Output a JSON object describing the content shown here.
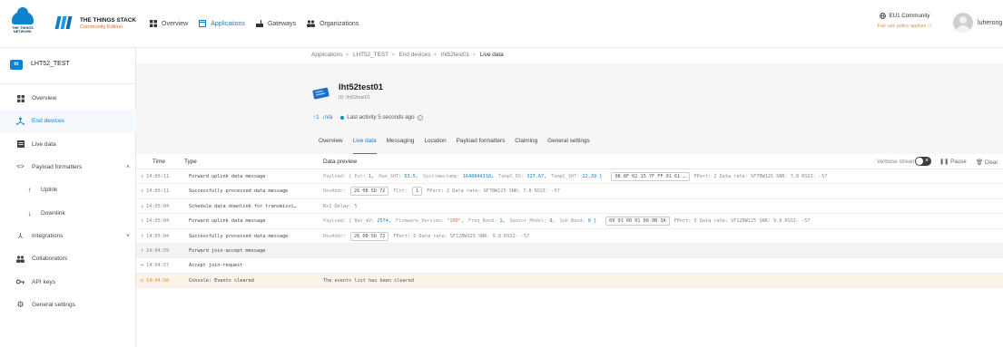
{
  "topbar": {
    "ttn_logo_text": "THE THINGS NETWORK",
    "stack_title": "THE THINGS STACK",
    "stack_edition": "Community Edition",
    "nav": [
      {
        "label": "Overview",
        "icon": "grid-icon"
      },
      {
        "label": "Applications",
        "icon": "window-icon",
        "active": true
      },
      {
        "label": "Gateways",
        "icon": "gateway-icon"
      },
      {
        "label": "Organizations",
        "icon": "people-icon"
      }
    ],
    "community": "EU1 Community",
    "fair_use": "Fair use policy applies ⓘ",
    "username": "luherong"
  },
  "sidebar": {
    "app_badge": "ttt",
    "app_name": "LHT52_TEST",
    "items": [
      {
        "label": "Overview",
        "icon": "grid-icon"
      },
      {
        "label": "End devices",
        "icon": "devices-icon",
        "active": true
      },
      {
        "label": "Live data",
        "icon": "list-icon"
      },
      {
        "label": "Payload formatters",
        "icon": "code-icon",
        "expanded": true
      },
      {
        "label": "Uplink",
        "icon": "arrow-up-icon",
        "sub": true
      },
      {
        "label": "Downlink",
        "icon": "arrow-down-icon",
        "sub": true
      },
      {
        "label": "Integrations",
        "icon": "integrations-icon",
        "collapsed": true
      },
      {
        "label": "Collaborators",
        "icon": "people-icon"
      },
      {
        "label": "API keys",
        "icon": "key-icon"
      },
      {
        "label": "General settings",
        "icon": "gear-icon"
      }
    ]
  },
  "breadcrumb": [
    "Applications",
    "LHT52_TEST",
    "End devices",
    "lht52test01",
    "Live data"
  ],
  "device": {
    "name": "lht52test01",
    "id": "ID: lht52test01",
    "up": "↑1",
    "down": "↓n/a",
    "last_activity": "Last activity 5 seconds ago"
  },
  "tabs": [
    "Overview",
    "Live data",
    "Messaging",
    "Location",
    "Payload formatters",
    "Claiming",
    "General settings"
  ],
  "events_header": {
    "time": "Time",
    "type": "Type",
    "preview": "Data preview",
    "verbose": "Verbose stream",
    "pause": "Pause",
    "clear": "Clear"
  },
  "events": [
    {
      "arrow": "↑",
      "time": "14:05:11",
      "type": "Forward uplink data message",
      "preview": {
        "kind": "payload",
        "label": "Payload:",
        "fields": [
          [
            "Ext:",
            "1,"
          ],
          [
            "Hum_SHT:",
            "53.5,"
          ],
          [
            "Systimestamp:",
            "1648844318,"
          ],
          [
            "TempC_DS:",
            "327.67,"
          ],
          [
            "TempC_SHT:",
            "22.39 }"
          ]
        ],
        "open": "{",
        "hex": "08 8F 02 15 7F FF 01 61 …",
        "tail": "FPort: 2  Data rate: SF7BW125  SNR: 7.8  RSSI: -57"
      }
    },
    {
      "arrow": "↑",
      "time": "14:05:11",
      "type": "Successfully processed data message",
      "preview": {
        "kind": "devaddr",
        "label": "DevAddr:",
        "addr": "26 0B 5D 72",
        "fcnt_label": "FCnt:",
        "fcnt": "1",
        "tail": "FPort: 2  Data rate: SF7BW125  SNR: 7.8  RSSI: -57"
      }
    },
    {
      "arrow": "↓",
      "time": "14:05:04",
      "type": "Schedule data downlink for transmissi…",
      "preview": {
        "kind": "text",
        "text": "Rx1 Delay: 5"
      }
    },
    {
      "arrow": "↑",
      "time": "14:05:04",
      "type": "Forward uplink data message",
      "preview": {
        "kind": "payload",
        "label": "Payload:",
        "fields": [
          [
            "Bat_mV:",
            "2574,"
          ],
          [
            "Firmware_Version:",
            "\"100\","
          ],
          [
            "Freq_Band:",
            "1,"
          ],
          [
            "Sensor_Model:",
            "9,"
          ],
          [
            "Sub_Band:",
            "0 }"
          ]
        ],
        "open": "{",
        "hex": "09 01 00 01 00 0B 3A",
        "tail": "FPort: 5  Data rate: SF12BW125  SNR: 9.8  RSSI: -57"
      }
    },
    {
      "arrow": "↑",
      "time": "14:05:04",
      "type": "Successfully processed data message",
      "preview": {
        "kind": "devaddr",
        "label": "DevAddr:",
        "addr": "26 0B 5D 72",
        "fcnt_label": "",
        "fcnt": "",
        "tail": "FPort: 5  Data rate: SF12BW125  SNR: 9.8  RSSI: -57"
      }
    },
    {
      "arrow": "↑",
      "time": "14:04:59",
      "type": "Forward join-accept message",
      "highlight": true,
      "preview": {
        "kind": "text",
        "text": ""
      }
    },
    {
      "arrow": "⇔",
      "time": "14:04:57",
      "type": "Accept join-request",
      "preview": {
        "kind": "text",
        "text": ""
      }
    },
    {
      "arrow": "⇄",
      "time": "14:04:50",
      "type": "Console: Events cleared",
      "warn": true,
      "preview": {
        "kind": "text",
        "text": "The events list has been cleared"
      }
    }
  ],
  "colors": {
    "accent": "#0d83d0",
    "warning": "#e08a2a",
    "edition": "#e06c2a"
  }
}
